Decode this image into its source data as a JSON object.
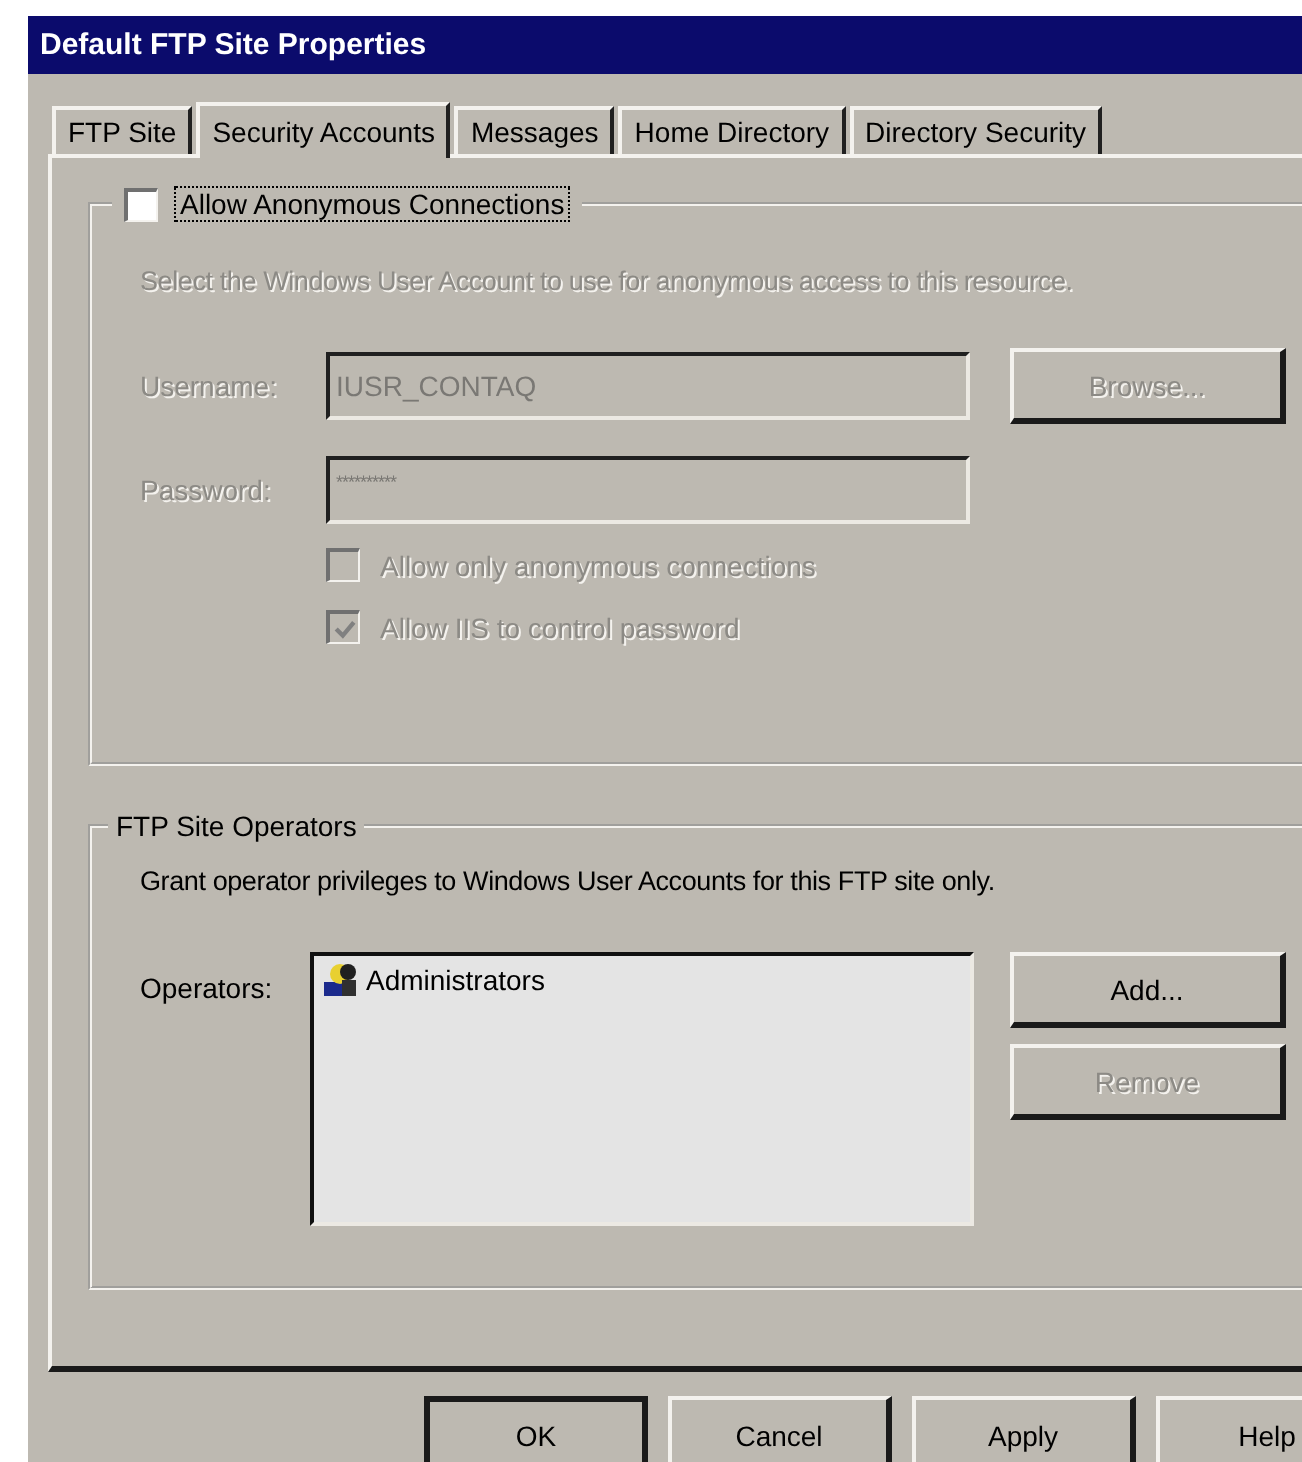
{
  "window": {
    "title": "Default FTP Site Properties"
  },
  "tabs": [
    {
      "label": "FTP Site",
      "selected": false
    },
    {
      "label": "Security Accounts",
      "selected": true
    },
    {
      "label": "Messages",
      "selected": false
    },
    {
      "label": "Home Directory",
      "selected": false
    },
    {
      "label": "Directory Security",
      "selected": false
    }
  ],
  "anonymous": {
    "label": "Allow Anonymous Connections",
    "checked": false,
    "description": "Select the Windows User Account to use for anonymous access to this resource.",
    "fields": [
      {
        "label": "Username:",
        "value": "IUSR_CONTAQ",
        "disabled": true
      },
      {
        "label": "Password:",
        "value": "**********",
        "disabled": true
      }
    ],
    "browse_button": {
      "label": "Browse...",
      "disabled": true
    },
    "options": [
      {
        "label": "Allow only anonymous connections",
        "checked": false,
        "disabled": true
      },
      {
        "label": "Allow IIS to control password",
        "checked": true,
        "disabled": true
      }
    ]
  },
  "operators": {
    "title": "FTP Site Operators",
    "description": "Grant operator privileges to Windows User Accounts for this FTP site only.",
    "label": "Operators:",
    "items": [
      {
        "name": "Administrators"
      }
    ],
    "buttons": [
      {
        "label": "Add...",
        "disabled": false
      },
      {
        "label": "Remove",
        "disabled": true
      }
    ]
  },
  "buttons": [
    {
      "label": "OK",
      "default": true
    },
    {
      "label": "Cancel",
      "default": false
    },
    {
      "label": "Apply",
      "default": false
    },
    {
      "label": "Help",
      "default": false
    }
  ]
}
